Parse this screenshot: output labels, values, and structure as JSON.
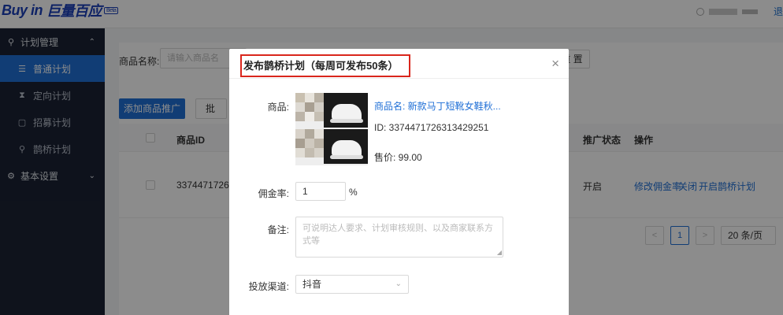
{
  "header": {
    "logo_en": "Buy in",
    "logo_cn": "巨量百应",
    "logo_badge": "Beta",
    "logout": "退"
  },
  "sidebar": {
    "groups": [
      {
        "label": "计划管理",
        "icon": "plan-icon",
        "chevron": "⌃"
      },
      {
        "label": "基本设置",
        "icon": "settings-icon",
        "chevron": "⌄"
      }
    ],
    "items": [
      {
        "label": "普通计划",
        "icon": "list-icon",
        "active": true
      },
      {
        "label": "定向计划",
        "icon": "hourglass-icon",
        "active": false
      },
      {
        "label": "招募计划",
        "icon": "recruit-icon",
        "active": false
      },
      {
        "label": "鹊桥计划",
        "icon": "bridge-icon",
        "active": false
      }
    ]
  },
  "filter": {
    "label": "商品名称:",
    "placeholder": "请输入商品名",
    "reset": "重 置"
  },
  "toolbar": {
    "add_product": "添加商品推广",
    "batch": "批"
  },
  "table": {
    "headers": {
      "product_id": "商品ID",
      "status": "推广状态",
      "actions": "操作"
    },
    "rows": [
      {
        "product_id": "33744717263",
        "status": "开启",
        "action_edit": "修改佣金率",
        "action_close": "关闭",
        "action_bridge": "开启鹊桥计划"
      }
    ]
  },
  "pagination": {
    "prev": "<",
    "current": "1",
    "next": ">",
    "page_size": "20 条/页"
  },
  "modal": {
    "title": "发布鹊桥计划（每周可发布50条）",
    "close": "×",
    "product_label": "商品:",
    "product_name": "商品名: 新款马丁短靴女鞋秋...",
    "product_id": "ID: 3374471726313429251",
    "product_price": "售价: 99.00",
    "rate_label": "佣金率:",
    "rate_value": "1",
    "rate_unit": "%",
    "remark_label": "备注:",
    "remark_placeholder": "可说明达人要求、计划审核规则、以及商家联系方式等",
    "channel_label": "投放渠道:",
    "channel_value": "抖音"
  },
  "colors": {
    "primary": "#1f6fd6",
    "sidebar_bg": "#1b2233",
    "highlight_border": "#d9261c"
  }
}
